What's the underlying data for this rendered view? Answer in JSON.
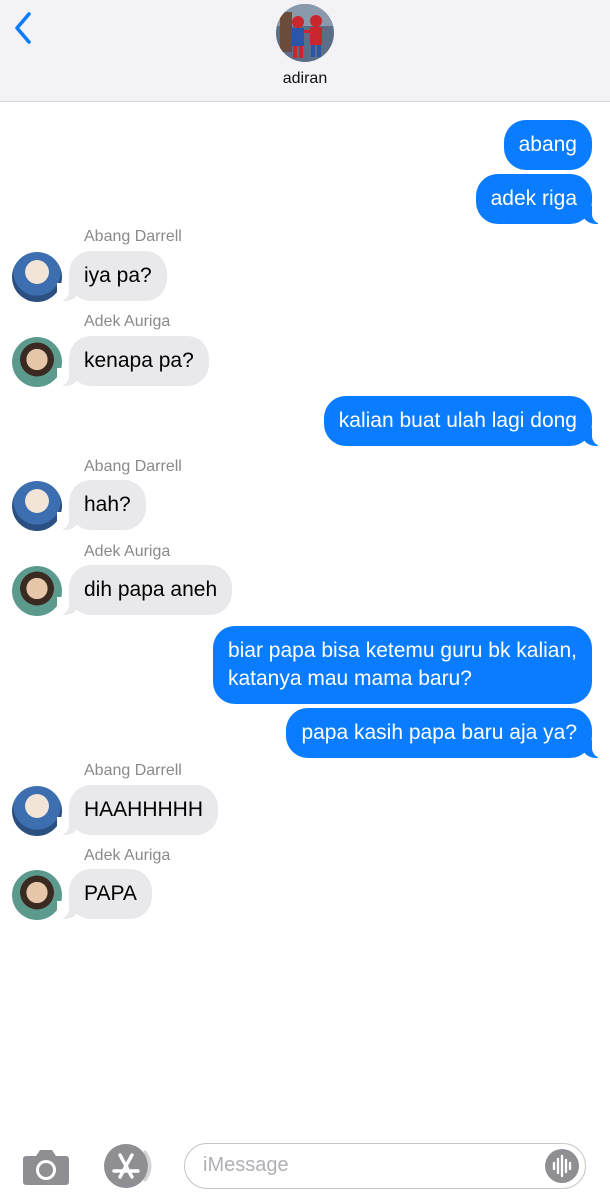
{
  "header": {
    "contact_name": "adiran",
    "back_icon": "chevron-left-icon",
    "accent_color": "#0a7cff"
  },
  "messages": [
    {
      "direction": "out",
      "text": "abang"
    },
    {
      "direction": "out",
      "text": "adek riga"
    },
    {
      "direction": "in",
      "sender": "Abang Darrell",
      "text": "iya pa?"
    },
    {
      "direction": "in",
      "sender": "Adek Auriga",
      "text": "kenapa pa?"
    },
    {
      "direction": "out",
      "text": "kalian buat ulah lagi dong"
    },
    {
      "direction": "in",
      "sender": "Abang Darrell",
      "text": "hah?"
    },
    {
      "direction": "in",
      "sender": "Adek Auriga",
      "text": "dih papa aneh"
    },
    {
      "direction": "out",
      "text": [
        "biar papa bisa ketemu guru bk kalian,",
        "katanya mau mama baru?"
      ]
    },
    {
      "direction": "out",
      "text": "papa kasih papa baru aja ya?"
    },
    {
      "direction": "in",
      "sender": "Abang Darrell",
      "text": "HAAHHHHH"
    },
    {
      "direction": "in",
      "sender": "Adek Auriga",
      "text": "PAPA"
    }
  ],
  "compose": {
    "placeholder": "iMessage",
    "camera_icon": "camera-icon",
    "apps_icon": "app-store-icon",
    "audio_icon": "audio-waveform-icon"
  },
  "colors": {
    "outgoing_bubble": "#0a7cff",
    "incoming_bubble": "#e9e9eb",
    "sender_label": "#8a8a8e"
  }
}
